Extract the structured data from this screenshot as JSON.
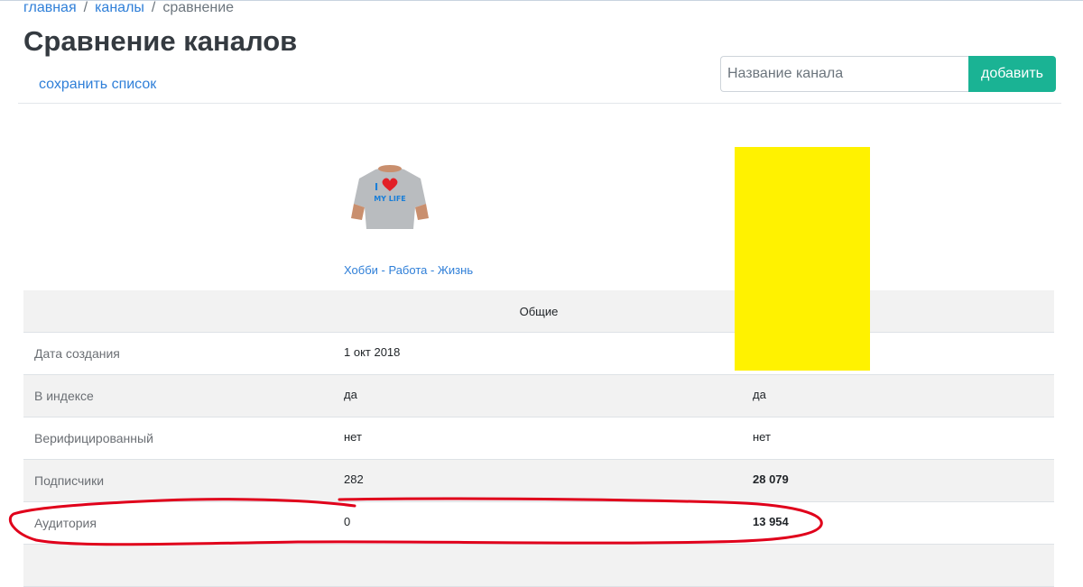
{
  "breadcrumb": {
    "home": "главная",
    "channels": "каналы",
    "current": "сравнение",
    "separator": "/"
  },
  "page": {
    "title": "Сравнение каналов"
  },
  "actions": {
    "save_list": "сохранить список"
  },
  "search": {
    "placeholder": "Название канала",
    "value": "",
    "add_label": "добавить"
  },
  "channel": {
    "name": "Хобби - Работа - Жизнь",
    "thumbnail_icon": "tshirt-icon",
    "thumbnail_text_1": "I",
    "thumbnail_text_2": "MY LIFE"
  },
  "table": {
    "section_label": "Общие",
    "rows": [
      {
        "label": "Дата создания",
        "a": "1 окт 2018",
        "b": ""
      },
      {
        "label": "В индексе",
        "a": "да",
        "b": "да"
      },
      {
        "label": "Верифицированный",
        "a": "нет",
        "b": "нет"
      },
      {
        "label": "Подписчики",
        "a": "282",
        "b": "28 079"
      },
      {
        "label": "Аудитория",
        "a": "0",
        "b": "13 954"
      }
    ]
  },
  "colors": {
    "accent": "#1ab394",
    "link": "#2f7fd8",
    "redaction": "#fff200",
    "annotation": "#e0001b"
  }
}
